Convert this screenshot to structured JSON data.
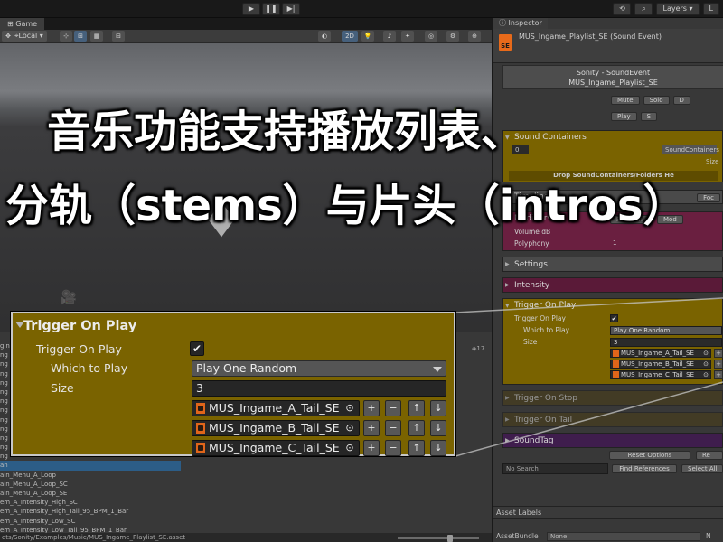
{
  "toolbar": {
    "play_icon": "▶",
    "pause_icon": "❚❚",
    "step_icon": "▶|",
    "history_icon": "history-icon",
    "search_icon": "search-icon",
    "layers_label": "Layers",
    "layout_label": "L"
  },
  "game": {
    "tab_label": "Game",
    "pivot_label": "Local",
    "mode_2d": "2D"
  },
  "project": {
    "items": [
      "gine",
      "ng",
      "ng",
      "ng",
      "ng",
      "ng",
      "ng",
      "ng",
      "ng",
      "ng",
      "ng",
      "ng",
      "ng",
      "an",
      "ain_Menu_A_Loop",
      "ain_Menu_A_Loop_SC",
      "ain_Menu_A_Loop_SE",
      "em_A_Intensity_High_SC",
      "em_A_Intensity_High_Tail_95_BPM_1_Bar",
      "em_A_Intensity_Low_SC",
      "em_A_Intensity_Low_Tail_95_BPM_1_Bar",
      "em_A_SE"
    ],
    "count_badge": "17",
    "path": "ets/Sonity/Examples/Music/MUS_Ingame_Playlist_SE.asset"
  },
  "inspector": {
    "tab_label": "Inspector",
    "object_title": "MUS_Ingame_Playlist_SE (Sound Event)",
    "se_badge": "SE",
    "sonity_title": "Sonity - SoundEvent",
    "sonity_name": "MUS_Ingame_Playlist_SE",
    "mute_label": "Mute",
    "solo_label": "Solo",
    "d_label": "D",
    "play_label": "Play",
    "s_label": "S",
    "sound_containers_label": "Sound Containers",
    "sound_containers_field": "SoundContainers",
    "size_label": "Size",
    "zero_value": "0",
    "drop_label": "Drop SoundContainers/Folders He",
    "timeline_label": "Timeline",
    "foc_label": "Foc",
    "modifiers_label": "Modifiers",
    "random_label": "Random",
    "mod_label": "Mod",
    "volume_label": "Volume dB",
    "polyphony_label": "Polyphony",
    "polyphony_value": "1",
    "settings_label": "Settings",
    "intensity_label": "Intensity",
    "trigger_on_play_label": "Trigger On Play",
    "trigger_on_play_field": "Trigger On Play",
    "which_to_play_label": "Which to Play",
    "which_to_play_value": "Play One Random",
    "size_field_label": "Size",
    "size_value": "3",
    "assets": [
      "MUS_Ingame_A_Tail_SE",
      "MUS_Ingame_B_Tail_SE",
      "MUS_Ingame_C_Tail_SE"
    ],
    "trigger_on_stop_label": "Trigger On Stop",
    "trigger_on_tail_label": "Trigger On Tail",
    "sound_tag_label": "SoundTag",
    "reset_options_label": "Reset Options",
    "re_label": "Re",
    "search_placeholder": "No Search",
    "find_references_label": "Find References",
    "select_all_label": "Select All",
    "asset_labels_label": "Asset Labels",
    "asset_bundle_label": "AssetBundle",
    "asset_bundle_value": "None",
    "asset_bundle_suffix": "N"
  },
  "zoom": {
    "section_title": "Trigger On Play",
    "trigger_label": "Trigger On Play",
    "which_label": "Which to Play",
    "which_value": "Play One Random",
    "size_label": "Size",
    "size_value": "3",
    "assets": [
      "MUS_Ingame_A_Tail_SE",
      "MUS_Ingame_B_Tail_SE",
      "MUS_Ingame_C_Tail_SE"
    ],
    "plus": "+",
    "minus": "−",
    "up": "↑",
    "down": "↓",
    "checkmark": "✔"
  },
  "caption": {
    "line1": "音乐功能支持播放列表、",
    "line2": "分轨（stems）与片头（intros）"
  },
  "colors": {
    "trigger_section": "#7a6300",
    "modifiers_section": "#6a1f40",
    "intensity_section": "#5a1a38",
    "sound_tag_section": "#3f1d4d",
    "stop_tail_section": "#4a3e1a"
  }
}
